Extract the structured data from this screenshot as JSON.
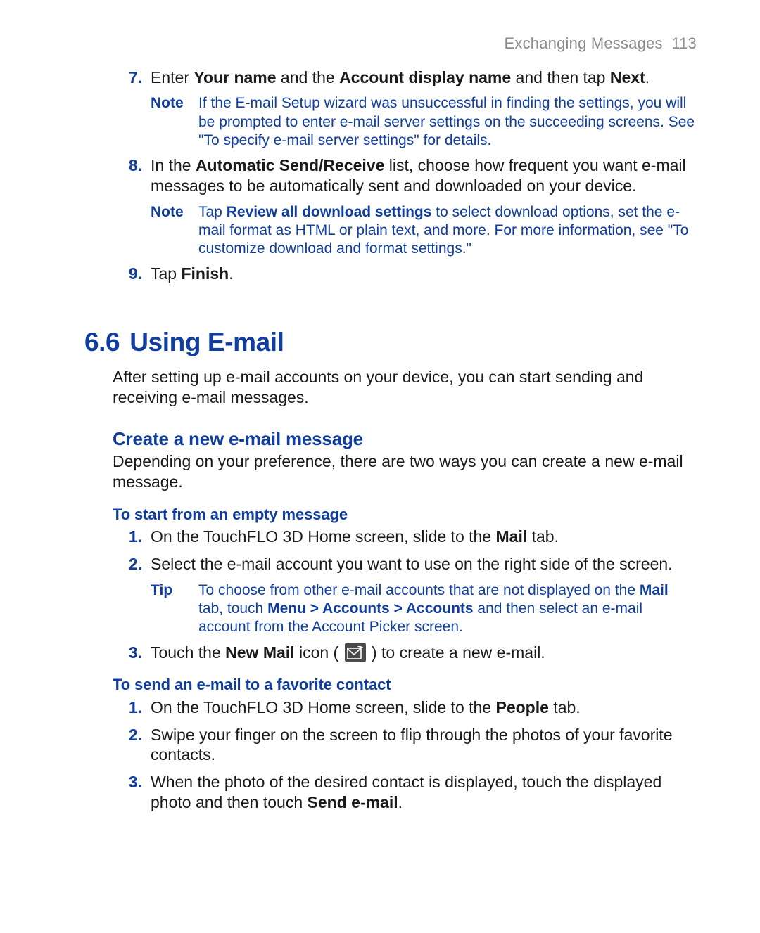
{
  "header": {
    "title": "Exchanging Messages",
    "page_num": "113"
  },
  "step7": {
    "num": "7.",
    "prefix": "Enter ",
    "b1": "Your name",
    "mid1": " and the ",
    "b2": "Account display name",
    "mid2": " and then tap ",
    "b3": "Next",
    "suffix": "."
  },
  "note7": {
    "label": "Note",
    "text": "If the E-mail Setup wizard was unsuccessful in finding the settings, you will be prompted to enter e-mail server settings on the succeeding screens. See \"To specify e-mail server settings\" for details."
  },
  "step8": {
    "num": "8.",
    "prefix": "In the ",
    "b1": "Automatic Send/Receive",
    "suffix": " list, choose how frequent you want e-mail messages to be automatically sent and downloaded on your device."
  },
  "note8": {
    "label": "Note",
    "pre": "Tap ",
    "b1": "Review all download settings",
    "post": " to select download options, set the e-mail format as HTML or plain text, and more. For more information, see \"To customize download and format settings.\""
  },
  "step9": {
    "num": "9.",
    "prefix": "Tap ",
    "b1": "Finish",
    "suffix": "."
  },
  "section": {
    "num": "6.6",
    "title": "Using E-mail"
  },
  "section_para": "After setting up e-mail accounts on your device, you can start sending and receiving e-mail messages.",
  "sub1": {
    "title": "Create a new e-mail message"
  },
  "sub1_para": "Depending on your preference, there are two ways you can create a new e-mail message.",
  "ss1": {
    "title": "To start from an empty message"
  },
  "ss1_1": {
    "num": "1.",
    "pre": "On the TouchFLO 3D Home screen, slide to the ",
    "b1": "Mail",
    "post": " tab."
  },
  "ss1_2": {
    "num": "2.",
    "text": "Select the e-mail account you want to use on the right side of the screen."
  },
  "tip1": {
    "label": "Tip",
    "pre": "To choose from other e-mail accounts that are not displayed on the ",
    "b1": "Mail",
    "mid1": " tab, touch ",
    "b2": "Menu > Accounts > Accounts",
    "post": " and then select an e-mail account from the Account Picker screen."
  },
  "ss1_3": {
    "num": "3.",
    "pre": "Touch the ",
    "b1": "New Mail",
    "mid": " icon ( ",
    "post": " ) to create a new e-mail."
  },
  "ss2": {
    "title": "To send an e-mail to a favorite contact"
  },
  "ss2_1": {
    "num": "1.",
    "pre": "On the TouchFLO 3D Home screen, slide to the ",
    "b1": "People",
    "post": " tab."
  },
  "ss2_2": {
    "num": "2.",
    "text": "Swipe your finger on the screen to flip through the photos of your favorite contacts."
  },
  "ss2_3": {
    "num": "3.",
    "pre": "When the photo of the desired contact is displayed, touch the displayed photo and then touch ",
    "b1": "Send e-mail",
    "post": "."
  }
}
